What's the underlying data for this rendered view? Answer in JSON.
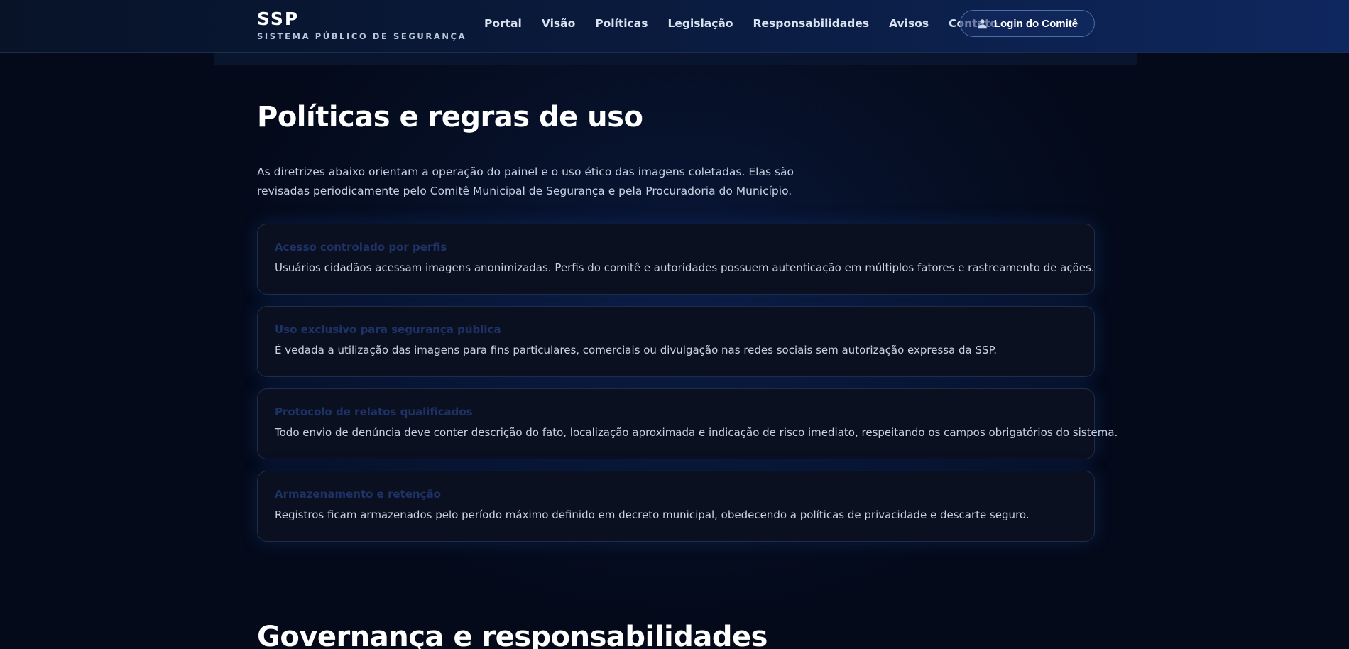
{
  "header": {
    "brand": {
      "title": "SSP",
      "subtitle": "SISTEMA PÚBLICO DE SEGURANÇA"
    },
    "nav": [
      {
        "label": "Portal"
      },
      {
        "label": "Visão"
      },
      {
        "label": "Políticas"
      },
      {
        "label": "Legislação"
      },
      {
        "label": "Responsabilidades"
      },
      {
        "label": "Avisos"
      },
      {
        "label": "Contato"
      }
    ],
    "login_button": {
      "label": "Login do Comitê",
      "icon": "user-icon"
    }
  },
  "main": {
    "title": "Políticas e regras de uso",
    "intro_lines": [
      "As diretrizes abaixo orientam a operação do painel e o uso ético das imagens coletadas. Elas são",
      "revisadas periodicamente pelo Comitê Municipal de Segurança e pela Procuradoria do Município."
    ],
    "policies": [
      {
        "title": "Acesso controlado por perfis",
        "text": "Usuários cidadãos acessam imagens anonimizadas. Perfis do comitê e autoridades possuem autenticação em múltiplos fatores e rastreamento de ações."
      },
      {
        "title": "Uso exclusivo para segurança pública",
        "text": "É vedada a utilização das imagens para fins particulares, comerciais ou divulgação nas redes sociais sem autorização expressa da SSP."
      },
      {
        "title": "Protocolo de relatos qualificados",
        "text": "Todo envio de denúncia deve conter descrição do fato, localização aproximada e indicação de risco imediato, respeitando os campos obrigatórios do sistema."
      },
      {
        "title": "Armazenamento e retenção",
        "text": "Registros ficam armazenados pelo período máximo definido em decreto municipal, obedecendo a políticas de privacidade e descarte seguro."
      }
    ],
    "next_section_title": "Governança e responsabilidades"
  },
  "colors": {
    "background": "#040a1a",
    "header": "#0a1a3c",
    "card_background": "#0b1020",
    "card_title": "#1d3368",
    "button_border": "#4e6ea8"
  }
}
